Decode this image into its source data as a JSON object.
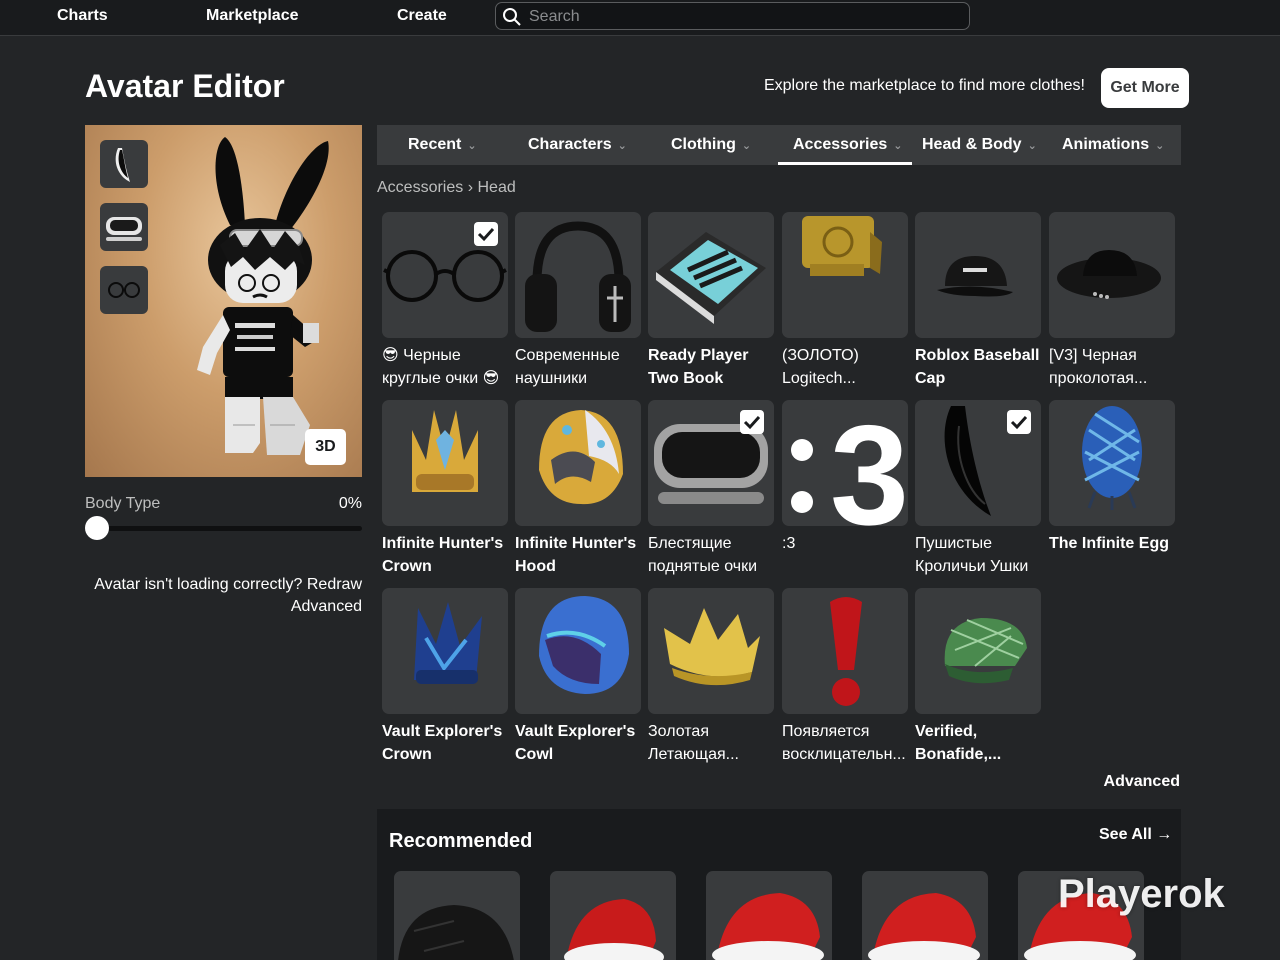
{
  "nav": {
    "charts": "Charts",
    "marketplace": "Marketplace",
    "create": "Create",
    "search_placeholder": "Search"
  },
  "header": {
    "title": "Avatar Editor",
    "explore_text": "Explore the marketplace to find more clothes!",
    "get_more": "Get More"
  },
  "avatar": {
    "equipped_icons": [
      "bunny-ears-icon",
      "goggles-icon",
      "round-glasses-icon"
    ],
    "btn_3d": "3D",
    "body_type_label": "Body Type",
    "body_type_value": "0%",
    "body_type_fraction": 0,
    "loading_text": "Avatar isn't loading correctly? Redraw",
    "advanced": "Advanced"
  },
  "tabs": [
    {
      "label": "Recent",
      "active": false
    },
    {
      "label": "Characters",
      "active": false
    },
    {
      "label": "Clothing",
      "active": false
    },
    {
      "label": "Accessories",
      "active": true
    },
    {
      "label": "Head & Body",
      "active": false
    },
    {
      "label": "Animations",
      "active": false
    }
  ],
  "breadcrumb": {
    "parent": "Accessories",
    "separator": "›",
    "current": "Head"
  },
  "items": [
    {
      "name": "😎 Черные круглые очки 😎",
      "selected": true,
      "icon": "round-glasses-icon"
    },
    {
      "name": "Современные наушники",
      "selected": false,
      "icon": "headphones-icon"
    },
    {
      "name": "Ready Player Two Book",
      "selected": false,
      "icon": "book-icon"
    },
    {
      "name": "(ЗОЛОТО) Logitech...",
      "selected": false,
      "icon": "gold-headset-icon"
    },
    {
      "name": "Roblox Baseball Cap",
      "selected": false,
      "icon": "baseball-cap-icon"
    },
    {
      "name": "[V3] Черная проколотая...",
      "selected": false,
      "icon": "black-hat-icon"
    },
    {
      "name": "Infinite Hunter's Crown",
      "selected": false,
      "icon": "hunter-crown-icon"
    },
    {
      "name": "Infinite Hunter's Hood",
      "selected": false,
      "icon": "hunter-hood-icon"
    },
    {
      "name": "Блестящие поднятые очки",
      "selected": true,
      "icon": "goggles-icon"
    },
    {
      "name": ":3",
      "selected": false,
      "icon": "cat-face-text-icon"
    },
    {
      "name": "Пушистые Кроличьи Ушки",
      "selected": true,
      "icon": "bunny-ears-icon"
    },
    {
      "name": "The Infinite Egg",
      "selected": false,
      "icon": "infinite-egg-icon"
    },
    {
      "name": "Vault Explorer's Crown",
      "selected": false,
      "icon": "vault-crown-icon"
    },
    {
      "name": "Vault Explorer's Cowl",
      "selected": false,
      "icon": "vault-cowl-icon"
    },
    {
      "name": "Золотая Летающая...",
      "selected": false,
      "icon": "gold-crown-icon"
    },
    {
      "name": "Появляется восклицательн...",
      "selected": false,
      "icon": "exclamation-icon"
    },
    {
      "name": "Verified, Bonafide,...",
      "selected": false,
      "icon": "green-cap-icon"
    }
  ],
  "advanced_link": "Advanced",
  "recommended": {
    "title": "Recommended",
    "see_all": "See All",
    "items": [
      "black-cap-icon",
      "santa-hat-icon",
      "santa-hat-icon",
      "santa-hat-icon",
      "santa-hat-icon"
    ]
  },
  "watermark": "Playerok"
}
